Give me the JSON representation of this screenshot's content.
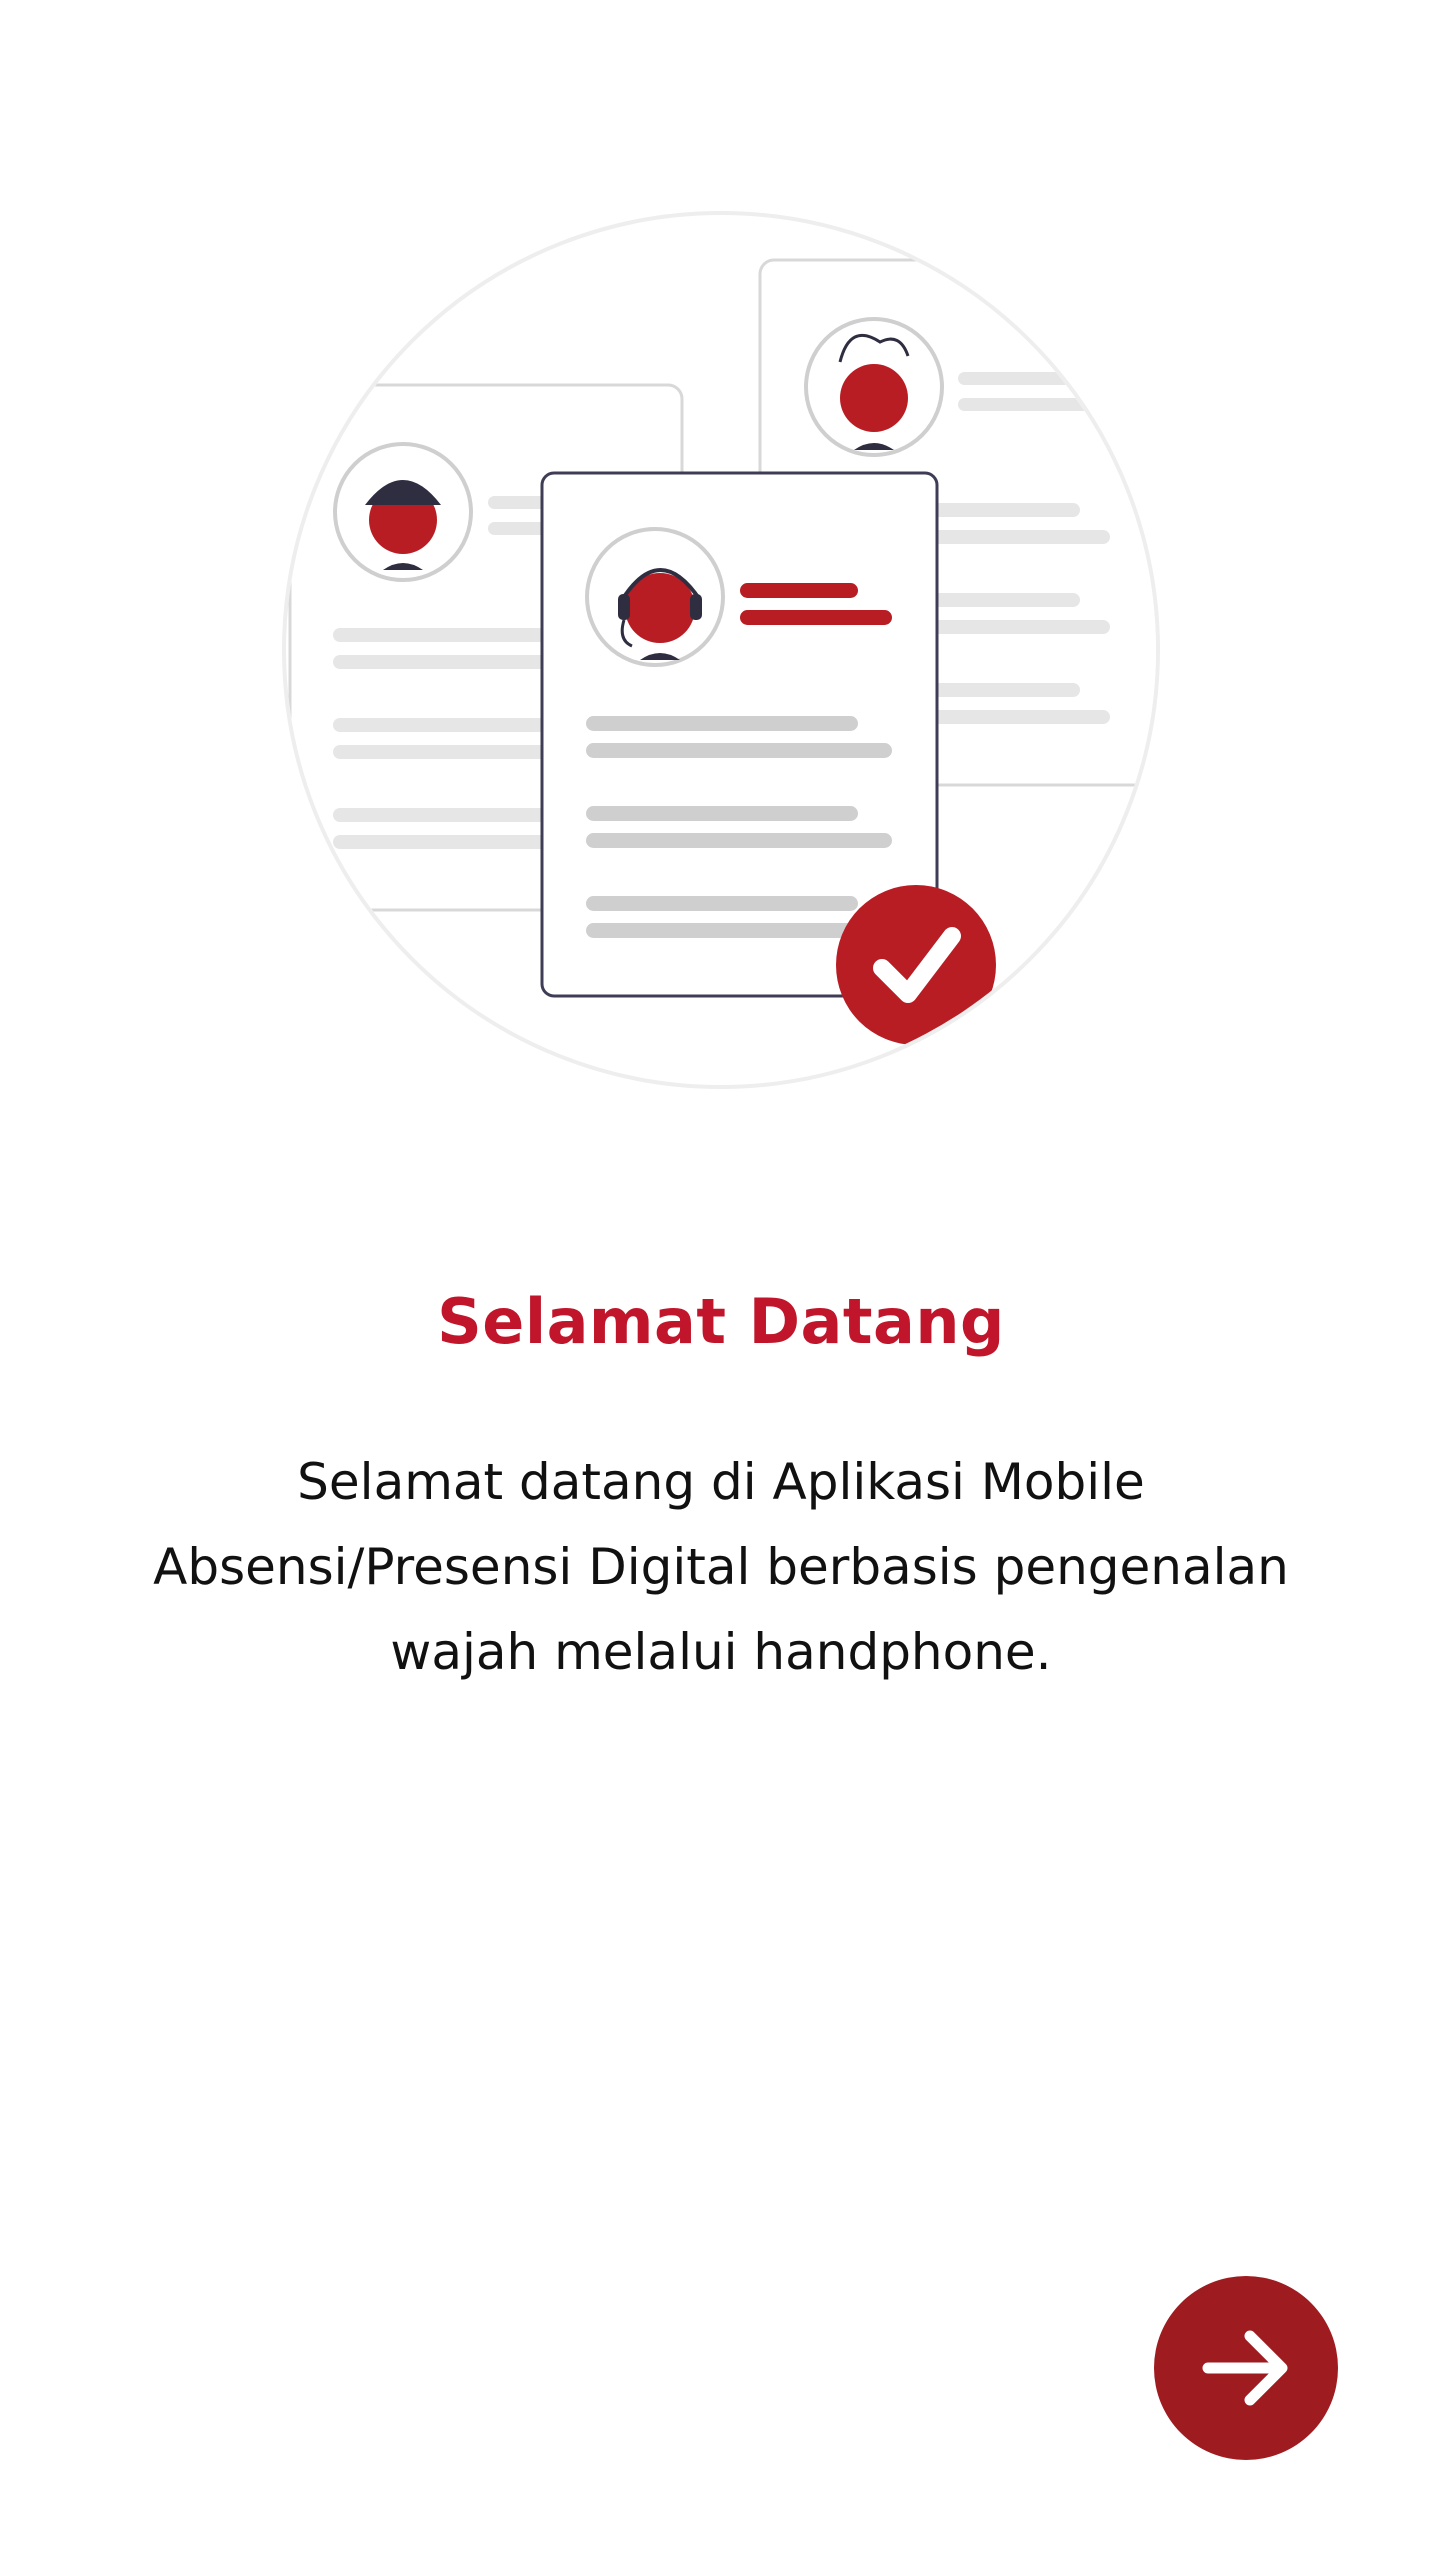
{
  "colors": {
    "accent": "#b81d24",
    "title": "#c0152a",
    "button": "#9e1b20",
    "text": "#111111",
    "placeholder_line": "#e6e6e6",
    "placeholder_line_dark": "#cfcfcf"
  },
  "illustration": {
    "icons": [
      "document-icon",
      "avatar-icon",
      "checkmark-icon"
    ]
  },
  "welcome": {
    "title": "Selamat Datang",
    "description": "Selamat datang di Aplikasi Mobile Absensi/Presensi Digital berbasis pengenalan wajah melalui handphone."
  },
  "navigation": {
    "next_icon": "arrow-right-icon"
  }
}
